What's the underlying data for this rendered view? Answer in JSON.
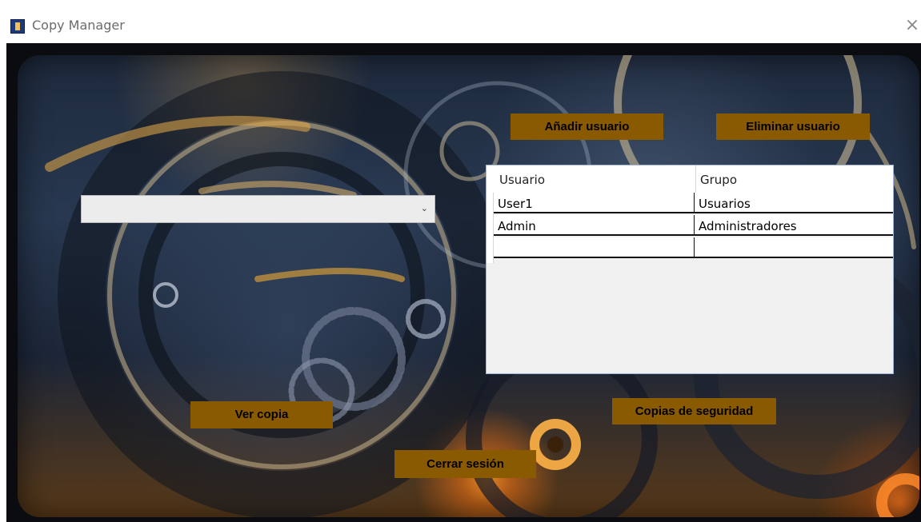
{
  "window": {
    "title": "Copy Manager",
    "close_glyph": "×"
  },
  "buttons": {
    "add_user": "Añadir usuario",
    "delete_user": "Eliminar usuario",
    "view_copy": "Ver copia",
    "backups": "Copias de seguridad",
    "logout": "Cerrar sesión"
  },
  "combo": {
    "value": "",
    "arrow_glyph": "⌄"
  },
  "grid": {
    "columns": [
      "Usuario",
      "Grupo"
    ],
    "rows": [
      [
        "User1",
        "Usuarios"
      ],
      [
        "Admin",
        "Administradores"
      ],
      [
        "",
        ""
      ]
    ]
  },
  "colors": {
    "button_bg": "#8a5a00",
    "button_text": "#000000"
  }
}
